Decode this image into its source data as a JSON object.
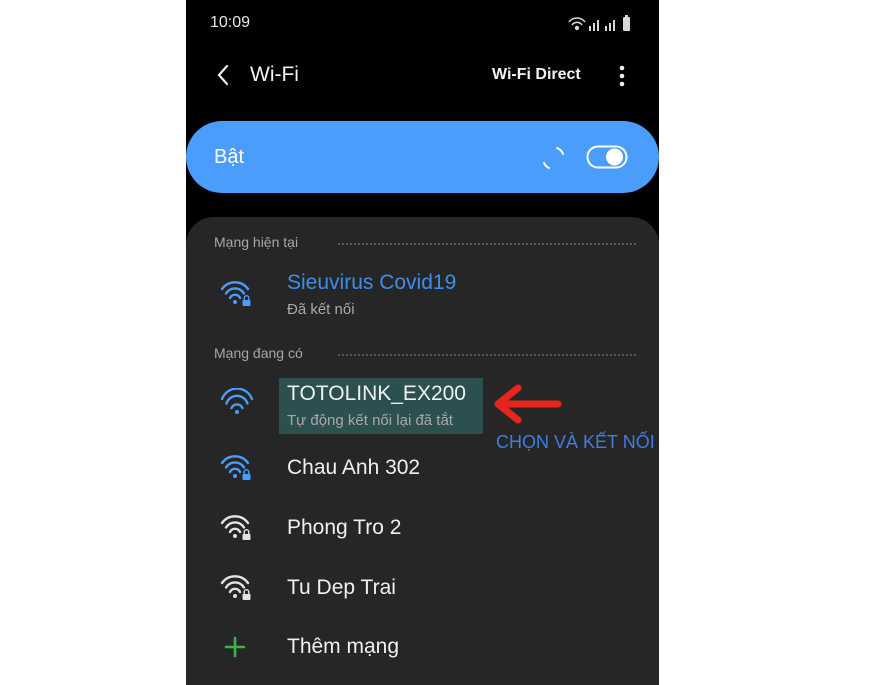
{
  "status_bar": {
    "time": "10:09"
  },
  "app_bar": {
    "title": "Wi-Fi",
    "action": "Wi-Fi Direct"
  },
  "toggle": {
    "label": "Bật",
    "state": "on"
  },
  "current_section": {
    "title": "Mạng hiện tại"
  },
  "current_network": {
    "name": "Sieuvirus Covid19",
    "status": "Đã kết nối"
  },
  "available_section": {
    "title": "Mạng đang có"
  },
  "networks": [
    {
      "name": "TOTOLINK_EX200",
      "status": "Tự động kết nối lại đã tắt"
    },
    {
      "name": "Chau Anh 302"
    },
    {
      "name": "Phong Tro 2"
    },
    {
      "name": "Tu Dep Trai"
    }
  ],
  "add_network": {
    "label": "Thêm mạng"
  },
  "annotation": {
    "text": "CHỌN VÀ KẾT NỐI"
  },
  "colors": {
    "accent": "#4a9dfa",
    "connected_text": "#3d8fe8",
    "annotation_arrow": "#e8251d",
    "add_icon": "#3ab34a"
  }
}
